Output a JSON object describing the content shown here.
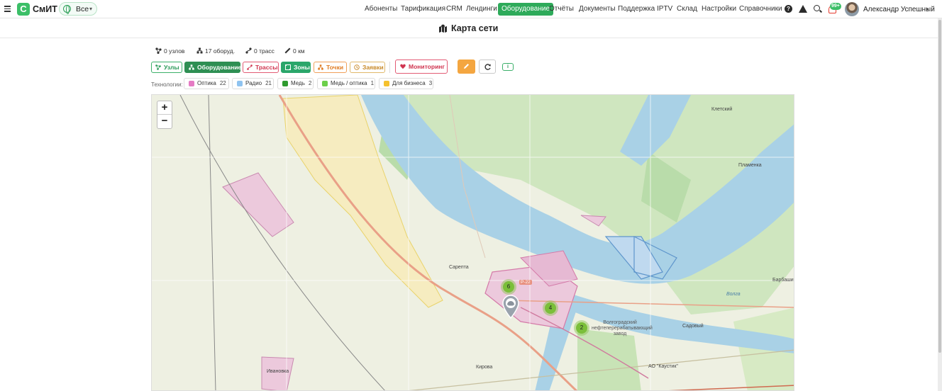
{
  "app": {
    "logo_letter": "С",
    "name": "СмИТ",
    "scope": "Все"
  },
  "nav": [
    {
      "label": "Абоненты",
      "active": false
    },
    {
      "label": "Тарификация",
      "active": false
    },
    {
      "label": "CRM",
      "active": false
    },
    {
      "label": "Лендинги",
      "active": false
    },
    {
      "label": "Оборудование",
      "active": true
    },
    {
      "label": "Отчёты",
      "active": false
    },
    {
      "label": "Документы",
      "active": false
    },
    {
      "label": "Поддержка",
      "active": false
    },
    {
      "label": "IPTV",
      "active": false
    },
    {
      "label": "Склад",
      "active": false
    },
    {
      "label": "Настройки",
      "active": false
    },
    {
      "label": "Справочники",
      "active": false
    }
  ],
  "header_icons": {
    "help": "?",
    "notifications_badge": "99+"
  },
  "user": {
    "name": "Александр Успешный"
  },
  "page": {
    "title": "Карта сети"
  },
  "stats": {
    "nodes": "0 узлов",
    "equipment": "17 оборуд.",
    "routes": "0 трасс",
    "length": "0 км"
  },
  "toolbar": {
    "nodes": "Узлы",
    "equipment": "Оборудование",
    "routes": "Трассы",
    "zones": "Зоны",
    "points": "Точки",
    "requests": "Заявки",
    "monitoring": "Мониторинг",
    "info": "i"
  },
  "technologies": {
    "label": "Технологии:",
    "items": [
      {
        "name": "Оптика",
        "count": "22",
        "color": "#e57bc4"
      },
      {
        "name": "Радио",
        "count": "21",
        "color": "#8fc3f0"
      },
      {
        "name": "Медь",
        "count": "2",
        "color": "#2e9a2e"
      },
      {
        "name": "Медь / оптика",
        "count": "1",
        "color": "#6ccf4a"
      },
      {
        "name": "Для бизнеса",
        "count": "3",
        "color": "#f5c12e"
      }
    ]
  },
  "map": {
    "zoom_in": "+",
    "zoom_out": "−",
    "labels": {
      "kletsky": "Клетский",
      "plamenka": "Пламенка",
      "barbashi": "Барбаши",
      "sadovy": "Садовый",
      "sarepta": "Сарепта",
      "ivanovka": "Ивановка",
      "kirova": "Кирова",
      "volga": "Волга",
      "refinery": "Волгоградский нефтеперерабатывающий завод",
      "kaustik": "АО \"Каустик\"",
      "road": "Р-22"
    },
    "clusters": [
      {
        "count": "6"
      },
      {
        "count": "4"
      },
      {
        "count": "2"
      }
    ]
  }
}
